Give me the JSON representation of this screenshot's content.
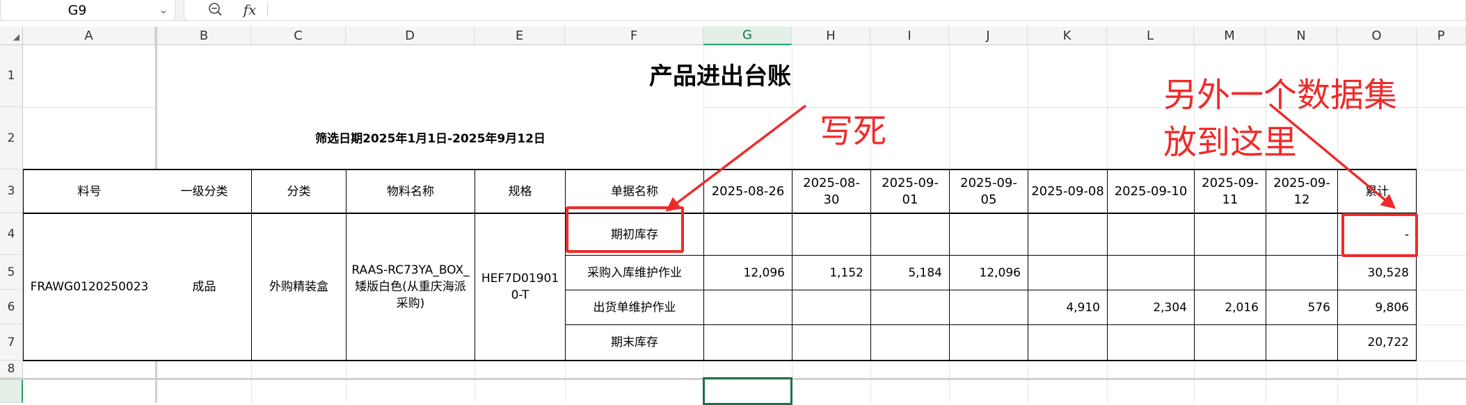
{
  "formula_bar": {
    "cell_reference": "G9",
    "dropdown_icon": "chevron-down-icon",
    "zoom_icon": "zoom-out-icon",
    "function_icon": "fx",
    "formula": ""
  },
  "columns": [
    "A",
    "B",
    "C",
    "D",
    "E",
    "F",
    "G",
    "H",
    "I",
    "J",
    "K",
    "L",
    "M",
    "N",
    "O",
    "P"
  ],
  "rows": [
    "1",
    "2",
    "3",
    "4",
    "5",
    "6",
    "7",
    "8"
  ],
  "selected_cell": "G9",
  "sheet": {
    "title": "产品进出台账",
    "filter_range": "筛选日期2025年1月1日-2025年9月12日",
    "headers": {
      "item_no": "料号",
      "category_1": "一级分类",
      "category": "分类",
      "material_name": "物料名称",
      "spec": "规格",
      "doc_name": "单据名称",
      "dates": [
        "2025-08-26",
        "2025-08-30",
        "2025-09-01",
        "2025-09-05",
        "2025-09-08",
        "2025-09-10",
        "2025-09-11",
        "2025-09-12"
      ],
      "total": "累计"
    },
    "record": {
      "item_no": "FRAWG0120250023",
      "category_1": "成品",
      "category": "外购精装盒",
      "material_name": "RAAS-RC73YA_BOX_矮版白色(从重庆海派采购)",
      "spec": "HEF7D019010-T"
    },
    "doc_rows": [
      {
        "name": "期初库存",
        "values": [
          "",
          "",
          "",
          "",
          "",
          "",
          "",
          ""
        ],
        "total": "-"
      },
      {
        "name": "采购入库维护作业",
        "values": [
          "12,096",
          "1,152",
          "5,184",
          "12,096",
          "",
          "",
          "",
          ""
        ],
        "total": "30,528"
      },
      {
        "name": "出货单维护作业",
        "values": [
          "",
          "",
          "",
          "",
          "4,910",
          "2,304",
          "2,016",
          "576"
        ],
        "total": "9,806"
      },
      {
        "name": "期末库存",
        "values": [
          "",
          "",
          "",
          "",
          "",
          "",
          "",
          ""
        ],
        "total": "20,722"
      }
    ]
  },
  "annotations": {
    "hardcode_note": "写死",
    "dataset_note_line1": "另外一个数据集",
    "dataset_note_line2": "放到这里",
    "color": "#ee2b2b"
  },
  "colors": {
    "accent_green": "#1e7145",
    "annotation_red": "#ee2b2b"
  }
}
